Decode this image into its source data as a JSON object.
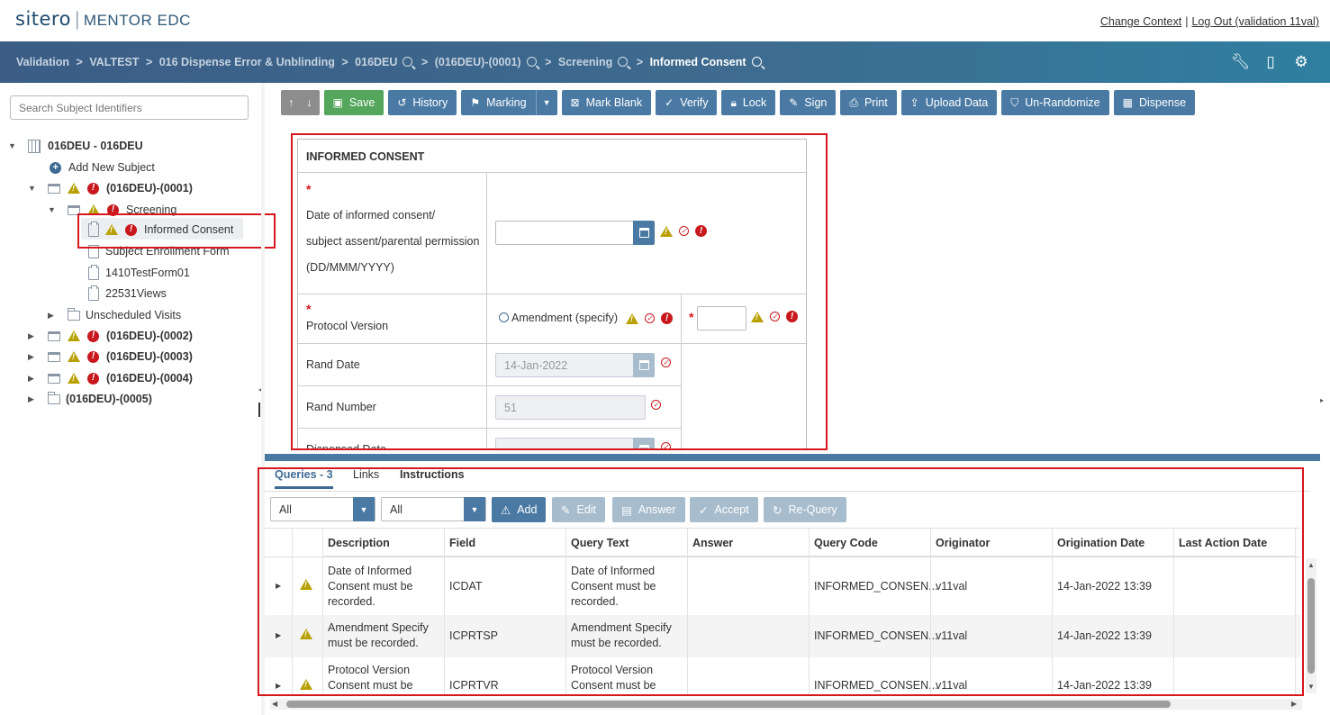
{
  "header": {
    "logo_brand": "sitero",
    "logo_product": "MENTOR EDC",
    "change_context": "Change Context",
    "logout": "Log Out (validation 11val)"
  },
  "breadcrumb": {
    "items": [
      "Validation",
      ">",
      "VALTEST",
      ">",
      "016 Dispense Error & Unblinding",
      ">",
      "016DEU",
      ">",
      "(016DEU)-(0001)",
      ">",
      "Screening",
      ">"
    ],
    "current": "Informed Consent"
  },
  "header_icons": [
    "wrench-icon",
    "book-icon",
    "gear-icon"
  ],
  "sidebar": {
    "search_placeholder": "Search Subject Identifiers",
    "site": "016DEU - 016DEU",
    "add_subject": "Add New Subject",
    "subjects": [
      {
        "label": "(016DEU)-(0001)",
        "warn": true,
        "error": true,
        "expanded": true
      },
      {
        "label": "(016DEU)-(0002)",
        "warn": true,
        "error": true
      },
      {
        "label": "(016DEU)-(0003)",
        "warn": true,
        "error": true
      },
      {
        "label": "(016DEU)-(0004)",
        "warn": true,
        "error": true
      },
      {
        "label": "(016DEU)-(0005)",
        "warn": false,
        "error": false
      }
    ],
    "visit": "Screening",
    "forms": [
      "Informed Consent",
      "Subject Enrollment Form",
      "1410TestForm01",
      "22531Views"
    ],
    "unscheduled": "Unscheduled Visits"
  },
  "toolbar": {
    "up": "↑",
    "down": "↓",
    "save": "Save",
    "history": "History",
    "marking": "Marking",
    "mark_blank": "Mark Blank",
    "verify": "Verify",
    "lock": "Lock",
    "sign": "Sign",
    "print": "Print",
    "upload": "Upload Data",
    "unrandomize": "Un-Randomize",
    "dispense": "Dispense"
  },
  "form": {
    "title": "INFORMED CONSENT",
    "req": "*",
    "date_label_1": "Date of informed consent/",
    "date_label_2": "subject assent/parental permission",
    "date_label_3": "(DD/MMM/YYYY)",
    "protocol_label": "Protocol Version",
    "amendment_option": "Amendment (specify)",
    "rand_date_label": "Rand Date",
    "rand_date_value": "14-Jan-2022",
    "rand_number_label": "Rand Number",
    "rand_number_value": "51",
    "dispensed_label": "Dispensed Date"
  },
  "queries": {
    "tabs": [
      "Queries - 3",
      "Links",
      "Instructions"
    ],
    "filter1": "All",
    "filter2": "All",
    "buttons": {
      "add": "Add",
      "edit": "Edit",
      "answer": "Answer",
      "accept": "Accept",
      "requery": "Re-Query"
    },
    "columns": [
      "Description",
      "Field",
      "Query Text",
      "Answer",
      "Query Code",
      "Originator",
      "Origination Date",
      "Last Action Date"
    ],
    "rows": [
      {
        "description": "Date of Informed Consent must be recorded.",
        "field": "ICDAT",
        "query_text": "Date of Informed Consent must be recorded.",
        "answer": "",
        "code": "INFORMED_CONSEN...",
        "originator": "v11val",
        "orig_date": "14-Jan-2022 13:39",
        "last_action": ""
      },
      {
        "description": "Amendment Specify must be recorded.",
        "field": "ICPRTSP",
        "query_text": "Amendment Specify must be recorded.",
        "answer": "",
        "code": "INFORMED_CONSEN...",
        "originator": "v11val",
        "orig_date": "14-Jan-2022 13:39",
        "last_action": ""
      },
      {
        "description": "Protocol Version Consent must be",
        "field": "ICPRTVR",
        "query_text": "Protocol Version Consent must be",
        "answer": "",
        "code": "INFORMED_CONSEN...",
        "originator": "v11val",
        "orig_date": "14-Jan-2022 13:39",
        "last_action": ""
      }
    ]
  },
  "colors": {
    "accent": "#4a7aa3",
    "save": "#53a65c",
    "warn": "#b8a000",
    "error": "#c8181e",
    "highlight": "#d6161c"
  }
}
